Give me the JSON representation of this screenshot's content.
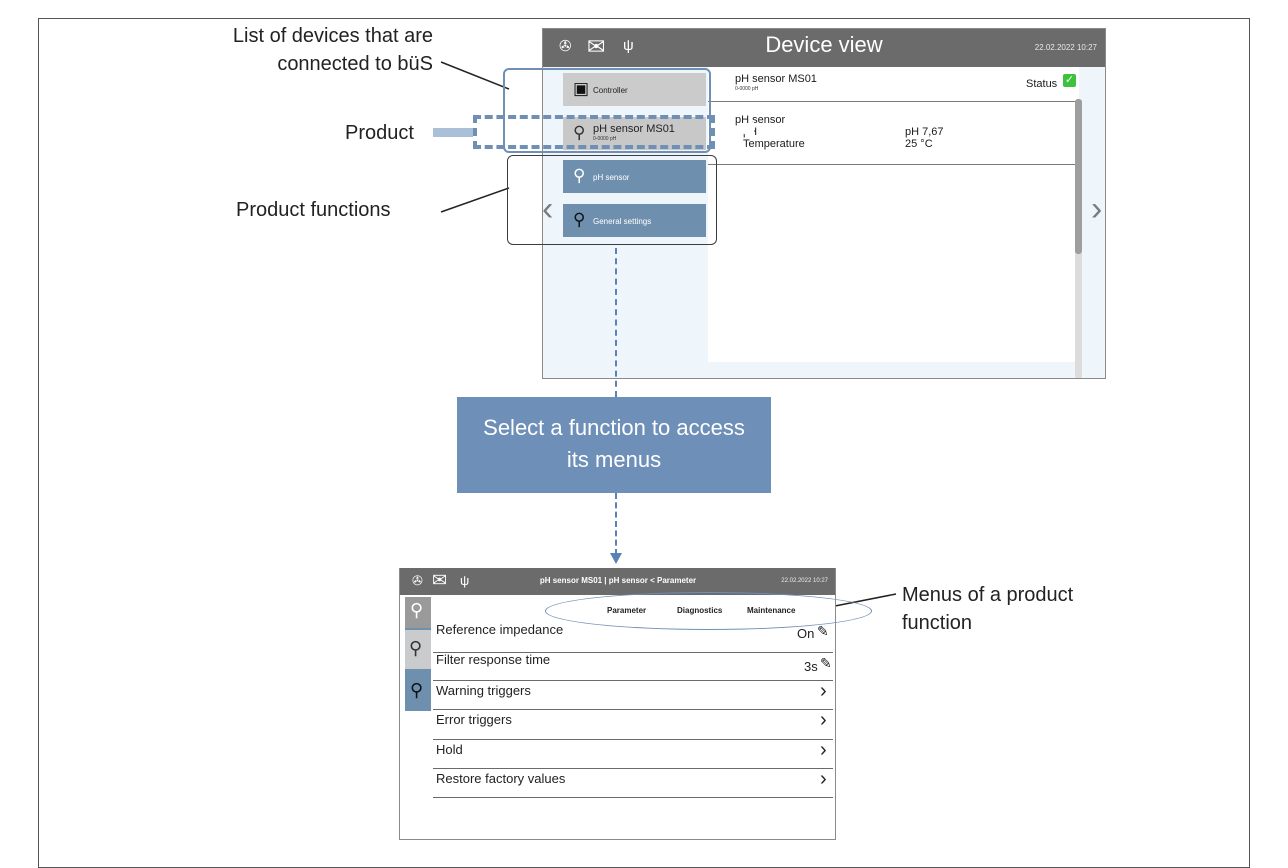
{
  "callouts": {
    "devices_line1": "List of devices that are",
    "devices_line2": "connected to büS",
    "product": "Product",
    "functions": "Product functions",
    "menus_line1": "Menus of a product",
    "menus_line2": "function"
  },
  "device_view": {
    "title": "Device view",
    "datetime": "22.02.2022  10:27",
    "header_icons": [
      "info-icon",
      "mail-icon",
      "usb-icon"
    ],
    "list": [
      {
        "label": "Controller",
        "icon": "controller-icon",
        "style": "gray"
      },
      {
        "label": "pH sensor MS01",
        "sublabel": "0-0000 pH",
        "icon": "sensor-icon",
        "style": "gray-selected"
      },
      {
        "label": "pH sensor",
        "icon": "sensor-icon",
        "style": "blue"
      },
      {
        "label": "General settings",
        "icon": "settings-icon",
        "style": "blue"
      }
    ],
    "content": {
      "device_name": "pH sensor MS01",
      "device_sub": "0-0000 pH",
      "status_label": "Status",
      "section": "pH sensor",
      "rows": [
        {
          "label": "pH",
          "value": "pH 7,67"
        },
        {
          "label": "Temperature",
          "value": "25 °C"
        }
      ]
    },
    "colors": {
      "header": "#6b6b6b",
      "button_blue": "#6e8fae",
      "button_gray": "#cbcbcb",
      "status_ok": "#3cc23c"
    }
  },
  "info_box": {
    "line1": "Select a function to access",
    "line2": "its menus",
    "color": "#6e8fb8"
  },
  "parameter_screen": {
    "title": "pH sensor MS01 | pH sensor < Parameter",
    "datetime": "22.02.2022  10:27",
    "tabs": [
      "Parameter",
      "Diagnostics",
      "Maintenance"
    ],
    "rows": [
      {
        "label": "Reference impedance",
        "value": "On",
        "action": "edit"
      },
      {
        "label": "Filter response time",
        "value": "3s",
        "action": "edit"
      },
      {
        "label": "Warning triggers",
        "value": "",
        "action": "navigate"
      },
      {
        "label": "Error triggers",
        "value": "",
        "action": "navigate"
      },
      {
        "label": "Hold",
        "value": "",
        "action": "navigate"
      },
      {
        "label": "Restore factory values",
        "value": "",
        "action": "navigate"
      }
    ]
  }
}
